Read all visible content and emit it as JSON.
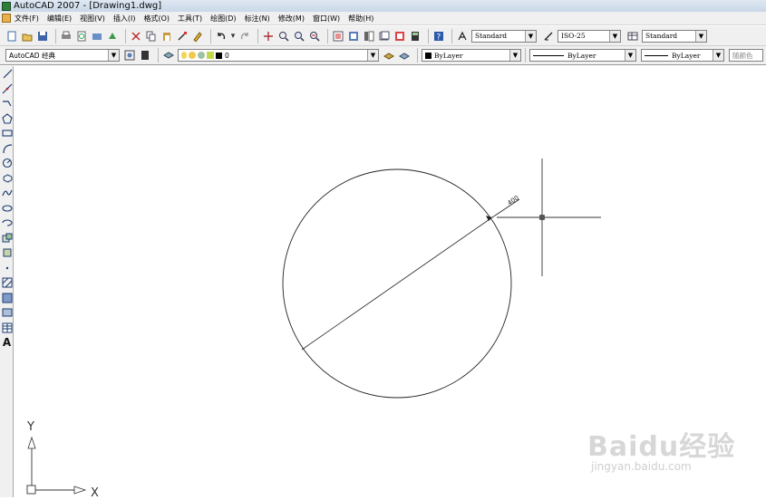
{
  "window": {
    "title": "AutoCAD 2007 - [Drawing1.dwg]"
  },
  "menu": [
    "文件(F)",
    "编辑(E)",
    "视图(V)",
    "插入(I)",
    "格式(O)",
    "工具(T)",
    "绘图(D)",
    "标注(N)",
    "修改(M)",
    "窗口(W)",
    "帮助(H)"
  ],
  "toolbar1": {
    "text_style": "Standard",
    "dim_style": "ISO-25",
    "table_style": "Standard"
  },
  "toolbar2": {
    "workspace": "AutoCAD 经典",
    "layer": "0",
    "color": "ByLayer",
    "linetype": "ByLayer",
    "lineweight": "ByLayer",
    "plot_style": "随颜色"
  },
  "left_tools": [
    "line-icon",
    "construction-line-icon",
    "polyline-icon",
    "polygon-icon",
    "rectangle-icon",
    "arc-icon",
    "circle-icon",
    "revision-cloud-icon",
    "spline-icon",
    "ellipse-icon",
    "ellipse-arc-icon",
    "insert-block-icon",
    "make-block-icon",
    "point-icon",
    "hatch-icon",
    "gradient-icon",
    "region-icon",
    "table-icon",
    "multiline-text-icon"
  ],
  "drawing": {
    "dimension_text": "400",
    "ucs_x": "X",
    "ucs_y": "Y"
  },
  "watermark": {
    "brand": "Baidu经验",
    "url": "jingyan.baidu.com"
  }
}
